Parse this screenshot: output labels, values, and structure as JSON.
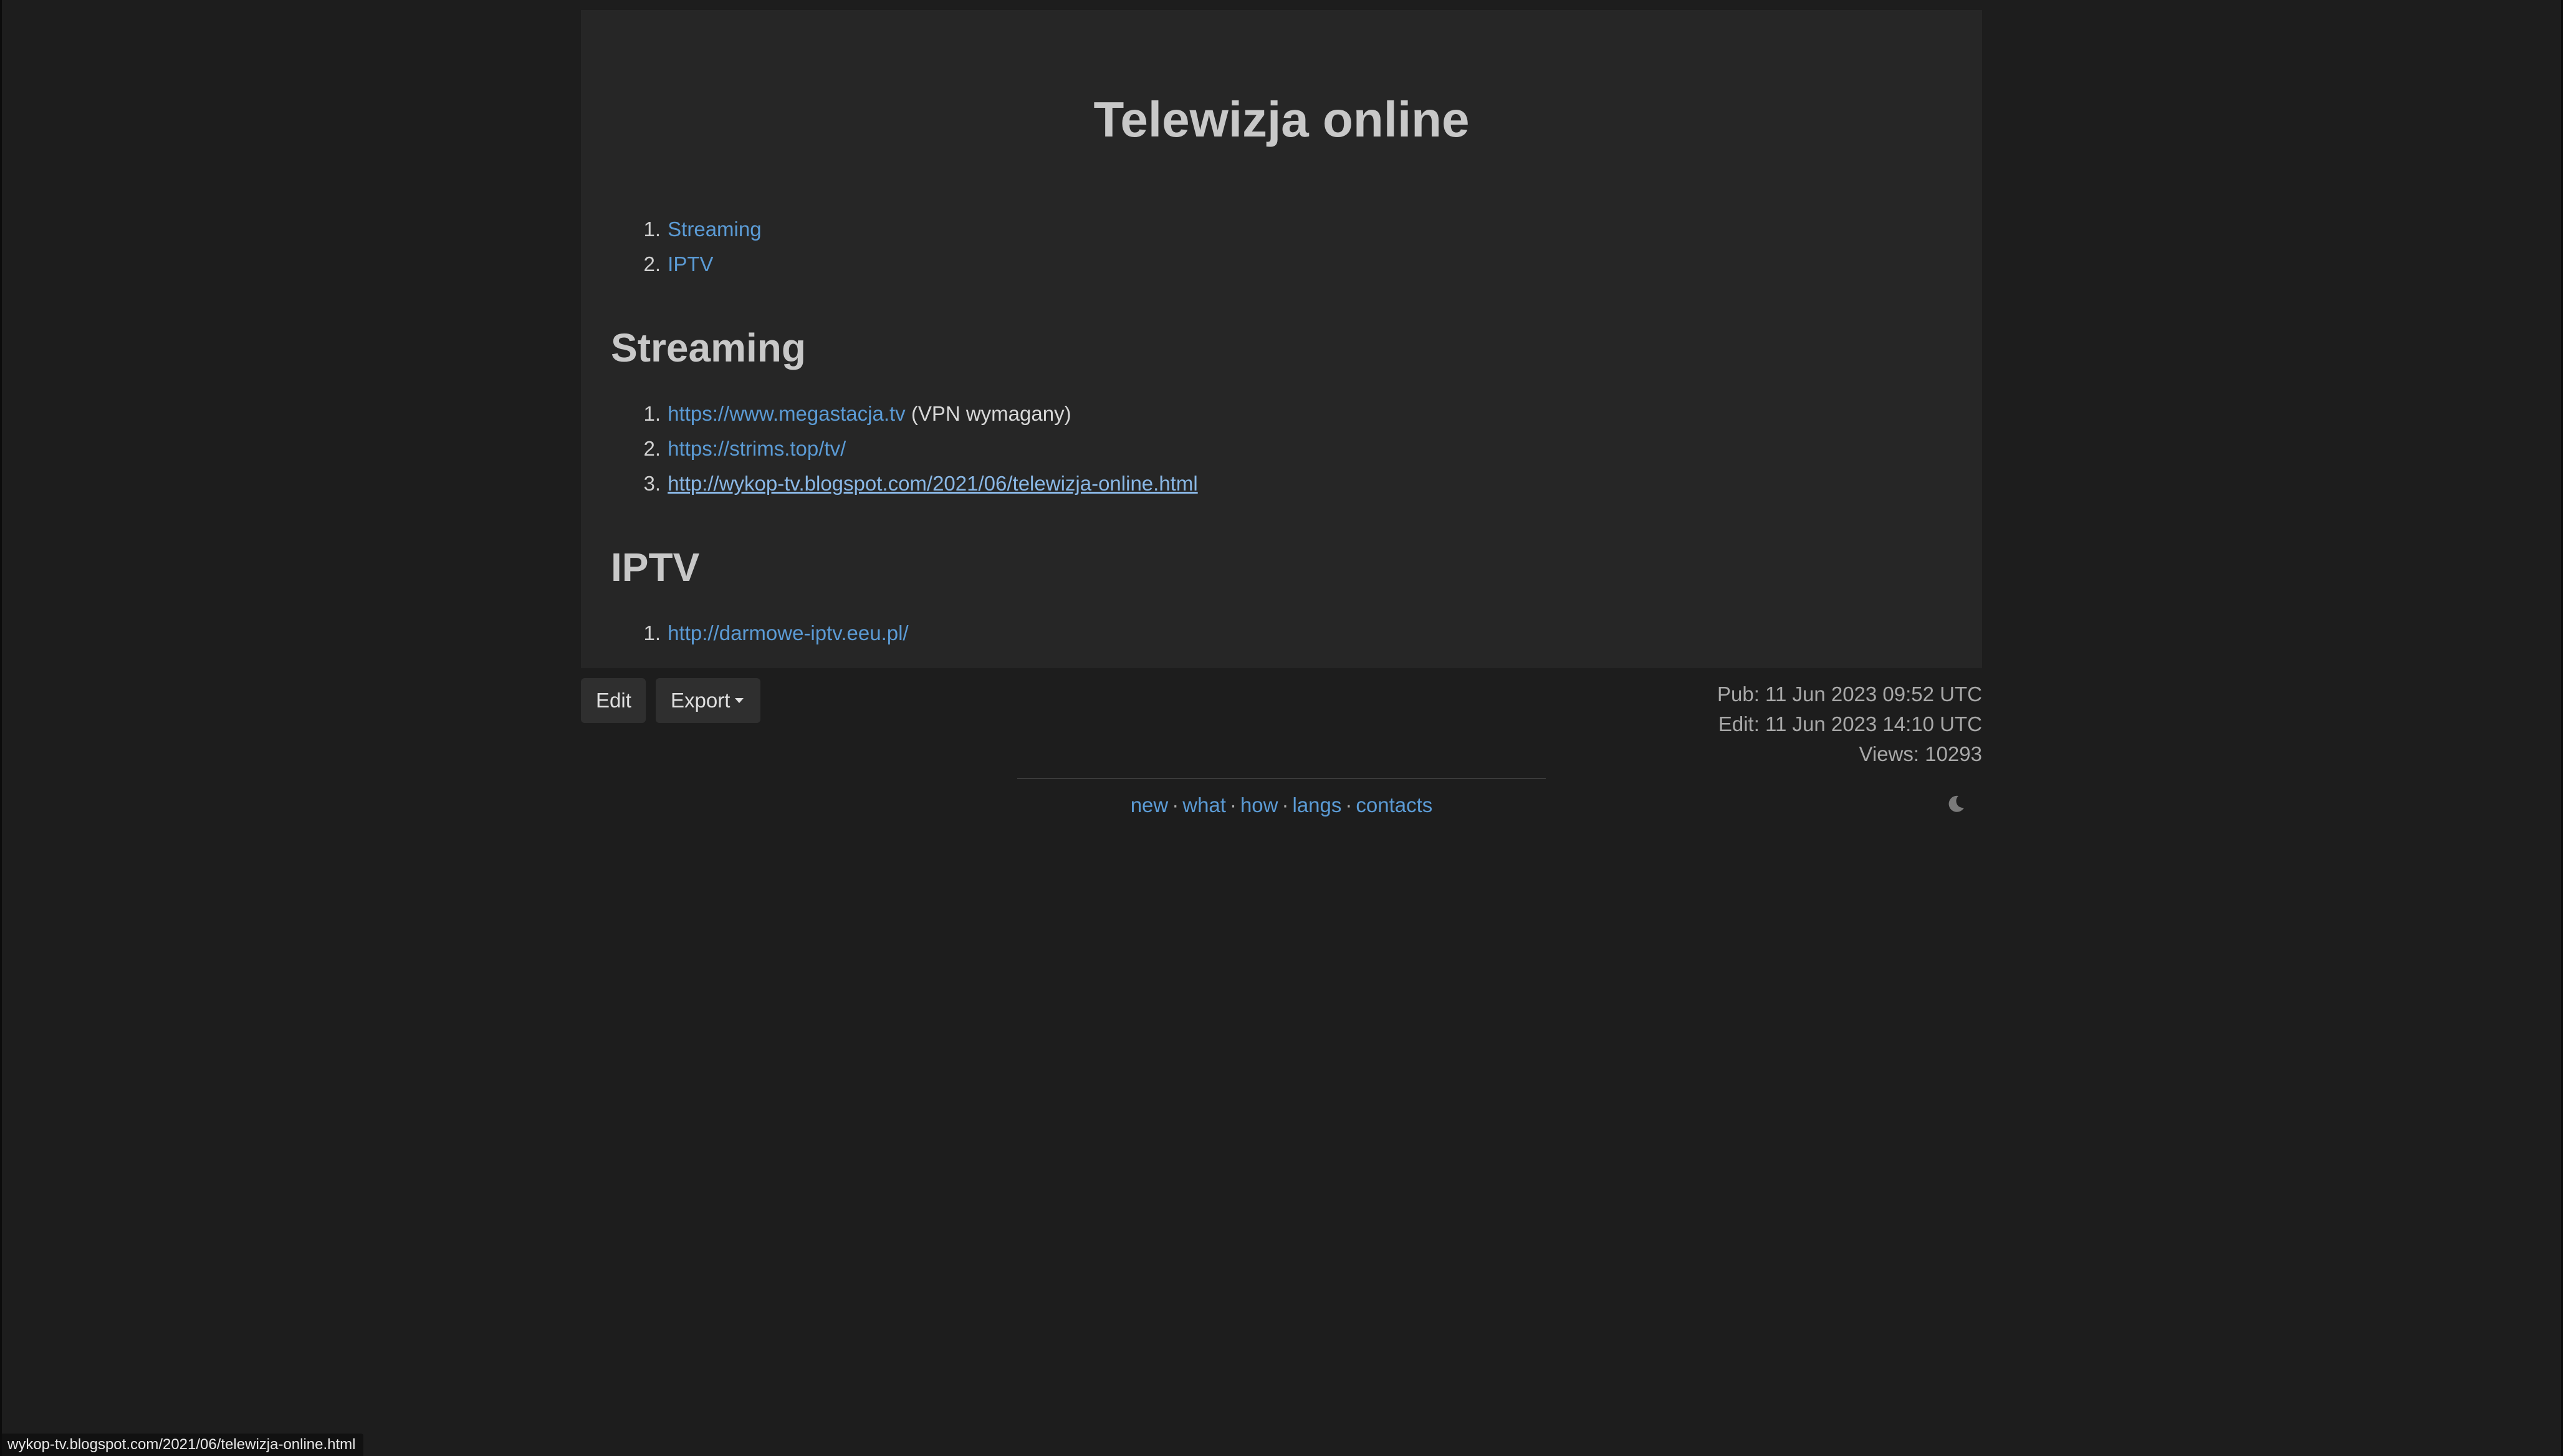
{
  "article": {
    "title": "Telewizja online",
    "toc": [
      {
        "num": "1.",
        "label": "Streaming"
      },
      {
        "num": "2.",
        "label": "IPTV"
      }
    ],
    "sections": [
      {
        "heading": "Streaming",
        "items": [
          {
            "num": "1.",
            "link": "https://www.megastacja.tv",
            "note": "(VPN wymagany)"
          },
          {
            "num": "2.",
            "link": "https://strims.top/tv/"
          },
          {
            "num": "3.",
            "link": "http://wykop-tv.blogspot.com/2021/06/telewizja-online.html"
          }
        ]
      },
      {
        "heading": "IPTV",
        "items": [
          {
            "num": "1.",
            "link": "http://darmowe-iptv.eeu.pl/"
          }
        ]
      }
    ]
  },
  "actions": {
    "edit_label": "Edit",
    "export_label": "Export"
  },
  "meta": {
    "pub": "Pub: 11 Jun 2023 09:52 UTC",
    "edit": "Edit: 11 Jun 2023 14:10 UTC",
    "views": "Views: 10293"
  },
  "footer": {
    "links": [
      "new",
      "what",
      "how",
      "langs",
      "contacts"
    ],
    "separator": "·",
    "theme_icon": "moon-icon"
  },
  "status_bar": {
    "url": "wykop-tv.blogspot.com/2021/06/telewizja-online.html"
  },
  "colors": {
    "background": "#1d1d1d",
    "card": "#262626",
    "link": "#5b9bd5"
  }
}
